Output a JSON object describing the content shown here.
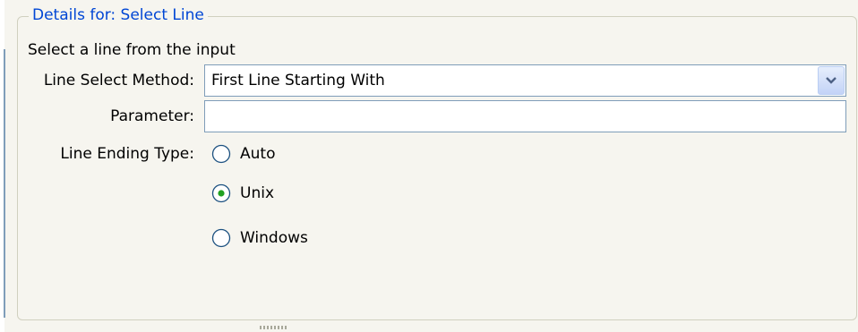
{
  "panel": {
    "legend": "Details for: Select Line",
    "description": "Select a line from the input"
  },
  "form": {
    "line_select_method": {
      "label": "Line Select Method:",
      "value": "First Line Starting With"
    },
    "parameter": {
      "label": "Parameter:",
      "value": ""
    },
    "line_ending_type": {
      "label": "Line Ending Type:",
      "options": [
        {
          "label": "Auto",
          "selected": false
        },
        {
          "label": "Unix",
          "selected": true
        },
        {
          "label": "Windows",
          "selected": false
        }
      ]
    }
  },
  "icons": {
    "dropdown": "chevron-down-icon"
  },
  "colors": {
    "legend_text": "#0046d5",
    "field_border": "#7f9db9",
    "background": "#f6f5ef",
    "radio_dot": "#21a121"
  }
}
